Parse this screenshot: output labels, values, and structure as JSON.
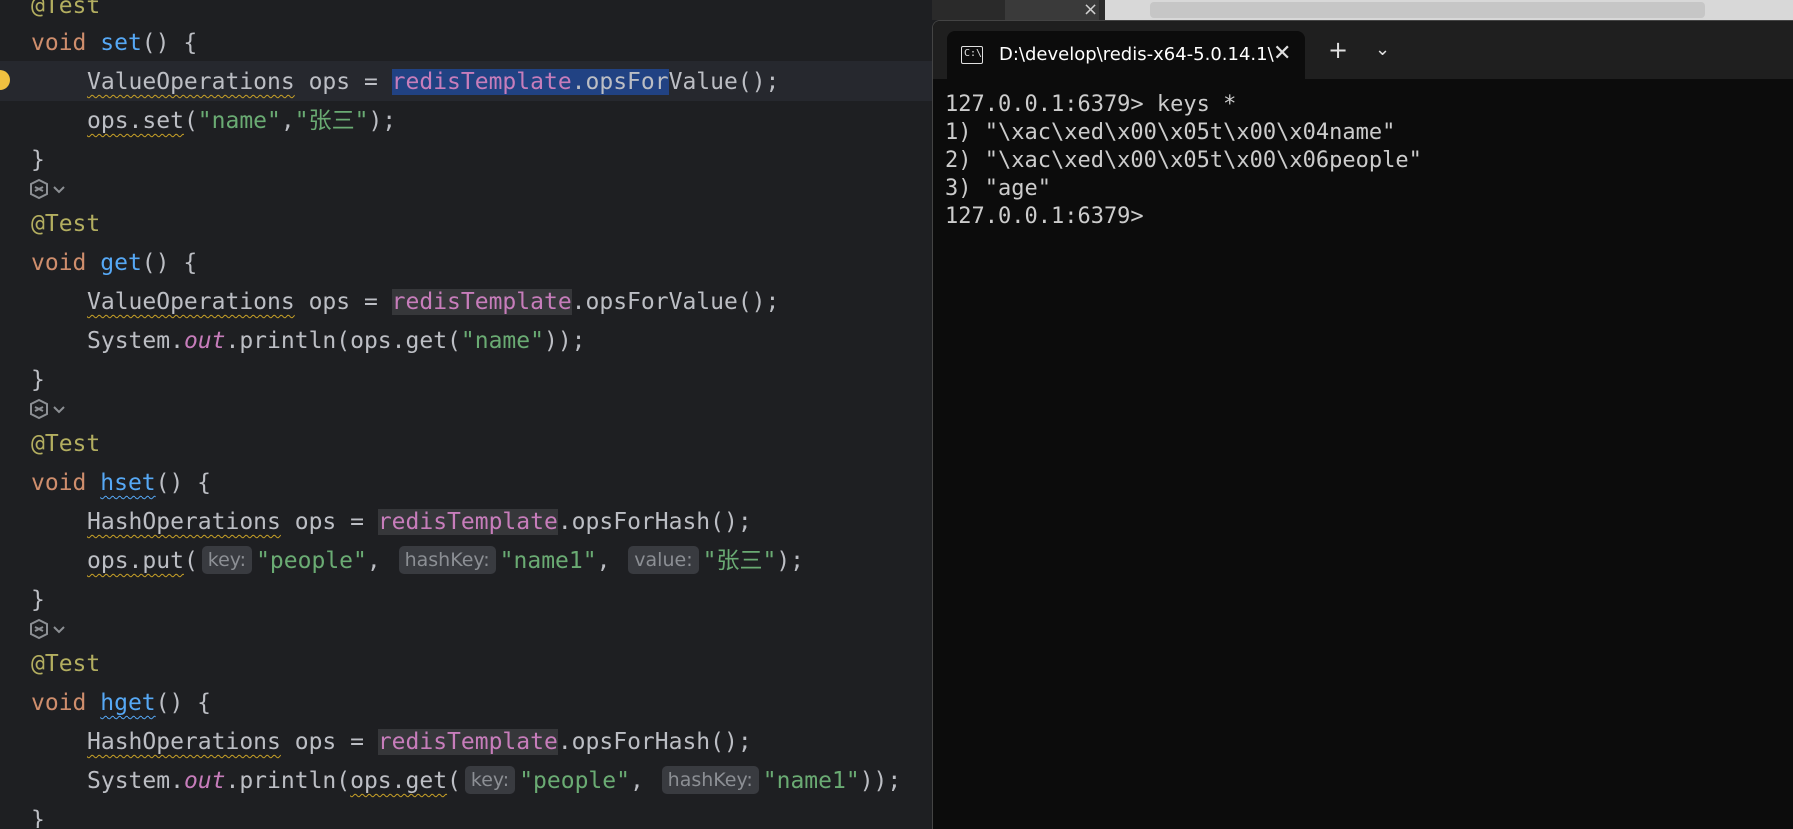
{
  "editor": {
    "lines": {
      "l0": "@Test",
      "l1_kw": "void",
      "l1_m": "set",
      "l1_rest": "() {",
      "l2_type": "ValueOperations",
      "l2_mid": " ops = ",
      "l2_field": "redisTemplate",
      "l2_call": ".opsForValue();",
      "l3_ops": "ops.set",
      "l3_open": "(",
      "l3_s1": "\"name\"",
      "l3_comma": ",",
      "l3_s2": "\"张三\"",
      "l3_close": ");",
      "brace": "}",
      "test": "@Test",
      "l6_m": "get",
      "l8_pre": "System.",
      "l8_out": "out",
      "l8_mid": ".println(ops.get(",
      "l8_s": "\"name\"",
      "l8_end": "));",
      "l11_m": "hset",
      "l12_type": "HashOperations",
      "l12_call": ".opsForHash();",
      "l13_ops": "ops.put",
      "hint_key": "key:",
      "hint_hashkey": "hashKey:",
      "hint_value": "value:",
      "l13_s1": "\"people\"",
      "l13_s2": "\"name1\"",
      "l13_s3": "\"张三\"",
      "sep": ", ",
      "l16_m": "hget",
      "l18_mid": ".println(",
      "l18_get": "ops.get",
      "l18_end": "));"
    }
  },
  "terminal": {
    "tab_title": "D:\\develop\\redis-x64-5.0.14.1\\",
    "tab_icon": "C:\\",
    "close": "✕",
    "new_tab": "+",
    "dropdown": "⌄",
    "strip_close": "×",
    "output": [
      "127.0.0.1:6379> keys *",
      "1) \"\\xac\\xed\\x00\\x05t\\x00\\x04name\"",
      "2) \"\\xac\\xed\\x00\\x05t\\x00\\x06people\"",
      "3) \"age\"",
      "127.0.0.1:6379>"
    ]
  }
}
